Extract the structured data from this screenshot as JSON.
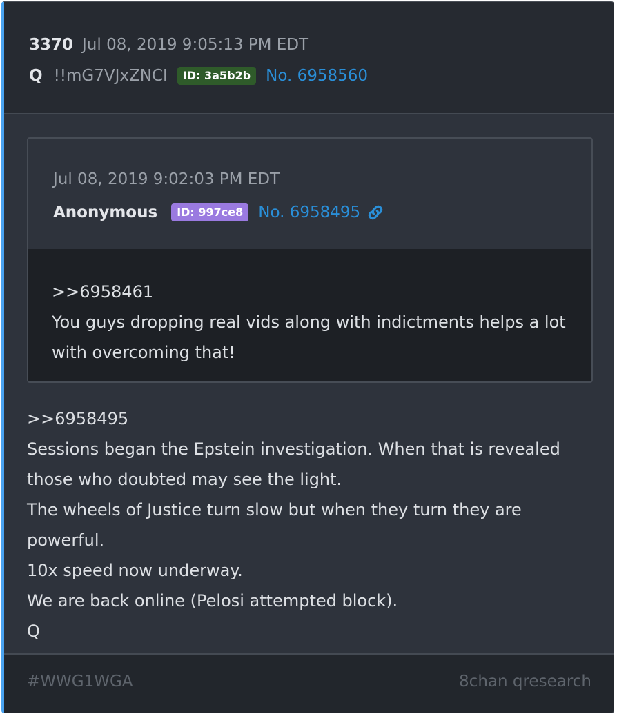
{
  "post": {
    "number": "3370",
    "date": "Jul 08, 2019 9:05:13 PM EDT",
    "author": "Q",
    "tripcode": "!!mG7VJxZNCI",
    "id_badge": "ID: 3a5b2b",
    "post_link": "No. 6958560",
    "body_lines": [
      ">>6958495",
      "Sessions began the Epstein investigation. When that is revealed",
      "those who doubted may see the light.",
      "The wheels of Justice turn slow but when they turn they are",
      "powerful.",
      "10x speed now underway.",
      "We are back online (Pelosi attempted block).",
      "Q"
    ]
  },
  "quote": {
    "date": "Jul 08, 2019 9:02:03 PM EDT",
    "author": "Anonymous",
    "id_badge": "ID: 997ce8",
    "post_link": "No. 6958495",
    "link_icon": "link-icon",
    "body_lines": [
      ">>6958461",
      "You guys dropping real vids along with indictments helps a lot",
      "with overcoming that!"
    ]
  },
  "footer": {
    "hashtag": "#WWG1WGA",
    "source": "8chan qresearch"
  },
  "colors": {
    "accent": "#4aa3f0",
    "link": "#2a8fd8",
    "badge_green": "#2f5b2a",
    "badge_purple": "#9a7ae0"
  }
}
